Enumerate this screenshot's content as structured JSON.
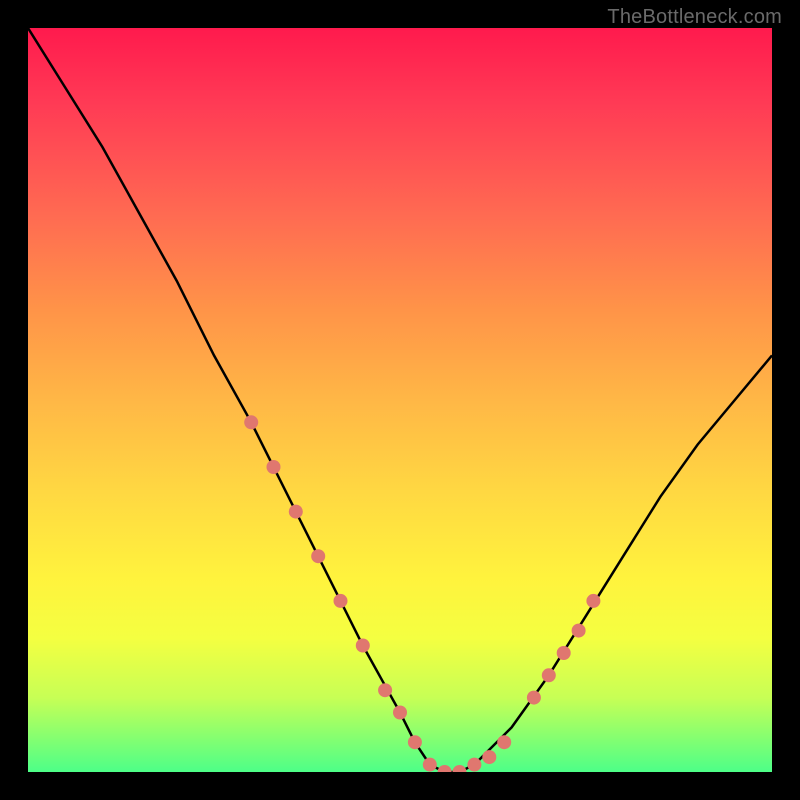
{
  "attribution": "TheBottleneck.com",
  "chart_data": {
    "type": "line",
    "title": "",
    "xlabel": "",
    "ylabel": "",
    "xlim": [
      0,
      100
    ],
    "ylim": [
      0,
      100
    ],
    "series": [
      {
        "name": "curve",
        "x": [
          0,
          5,
          10,
          15,
          20,
          25,
          30,
          35,
          40,
          45,
          50,
          52,
          54,
          56,
          58,
          60,
          65,
          70,
          75,
          80,
          85,
          90,
          95,
          100
        ],
        "y": [
          100,
          92,
          84,
          75,
          66,
          56,
          47,
          37,
          27,
          17,
          8,
          4,
          1,
          0,
          0,
          1,
          6,
          13,
          21,
          29,
          37,
          44,
          50,
          56
        ]
      }
    ],
    "markers": {
      "name": "highlight-dots",
      "color": "#e0776f",
      "x": [
        30,
        33,
        36,
        39,
        42,
        45,
        48,
        50,
        52,
        54,
        56,
        58,
        60,
        62,
        64,
        68,
        70,
        72,
        74,
        76
      ],
      "y": [
        47,
        41,
        35,
        29,
        23,
        17,
        11,
        8,
        4,
        1,
        0,
        0,
        1,
        2,
        4,
        10,
        13,
        16,
        19,
        23
      ]
    },
    "background_gradient": [
      {
        "pos": 0,
        "color": "#ff1a4d"
      },
      {
        "pos": 100,
        "color": "#4dff88"
      }
    ]
  }
}
